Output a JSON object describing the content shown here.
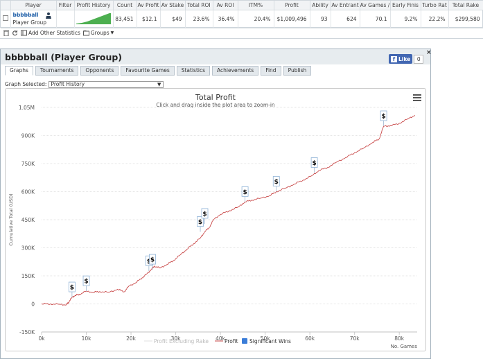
{
  "grid": {
    "headers": [
      "",
      "Player",
      "Filter",
      "Profit History",
      "Count",
      "Av Profit",
      "Av Stake",
      "Total ROI",
      "Av ROI",
      "ITM%",
      "Profit",
      "Ability",
      "Av Entrant",
      "Av Games /",
      "Early Finis",
      "Turbo Rat",
      "Total Rake",
      ""
    ],
    "row": {
      "player_name": "bbbbball",
      "player_sub": "Player Group",
      "count": "83,451",
      "av_profit": "$12.1",
      "av_stake": "$49",
      "total_roi": "23.6%",
      "av_roi": "36.4%",
      "itm": "20.4%",
      "profit": "$1,009,496",
      "ability": "93",
      "av_entrant": "624",
      "av_games": "70.1",
      "early_finis": "9.2%",
      "turbo_rat": "22.2%",
      "total_rake": "$299,580",
      "more": "»"
    },
    "sparkline_color": "#4caf50"
  },
  "toolbar": {
    "delete_icon": "trash-icon",
    "refresh_icon": "refresh-icon",
    "add_stats_label": "Add Other Statistics",
    "groups_label": "Groups"
  },
  "panel": {
    "title": "bbbbball (Player Group)",
    "fb_like_label": "Like",
    "fb_like_count": "0",
    "close": "×",
    "tabs": [
      "Graphs",
      "Tournaments",
      "Opponents",
      "Favourite Games",
      "Statistics",
      "Achievements",
      "Find",
      "Publish"
    ],
    "active_tab": "Graphs",
    "graph_selected_label": "Graph Selected:",
    "graph_selected_value": "Profit History"
  },
  "chart_data": {
    "type": "line",
    "title": "Total Profit",
    "subtitle": "Click and drag inside the plot area to zoom-in",
    "ylabel": "Cumulative Total (USD)",
    "xlabel": "No. Games",
    "xlim": [
      0,
      84000
    ],
    "ylim": [
      -150000,
      1050000
    ],
    "y_ticks": [
      -150000,
      0,
      150000,
      300000,
      450000,
      600000,
      750000,
      900000,
      1050000
    ],
    "y_tick_labels": [
      "-150K",
      "0",
      "150K",
      "300K",
      "450K",
      "600K",
      "750K",
      "900K",
      "1.05M"
    ],
    "x_ticks": [
      0,
      10000,
      20000,
      30000,
      40000,
      50000,
      60000,
      70000,
      80000
    ],
    "x_tick_labels": [
      "0k",
      "10k",
      "20k",
      "30k",
      "40k",
      "50k",
      "60k",
      "70k",
      "80k"
    ],
    "grid": true,
    "legend_position": "bottom",
    "series": [
      {
        "name": "Profit",
        "color": "#c94a4a",
        "x": [
          0,
          2000,
          4000,
          5500,
          6000,
          6800,
          7500,
          8500,
          10000,
          11500,
          13000,
          15000,
          17000,
          18500,
          19500,
          21000,
          22500,
          23500,
          24500,
          25200,
          26500,
          28000,
          29500,
          31000,
          32500,
          34000,
          35500,
          36500,
          37500,
          38500,
          40000,
          42000,
          44000,
          45500,
          47000,
          49000,
          51000,
          52500,
          54500,
          56500,
          58500,
          60500,
          62000,
          64000,
          66000,
          68000,
          70000,
          72000,
          74000,
          75500,
          76500,
          78000,
          80000,
          82000,
          83500
        ],
        "values": [
          0,
          0,
          -2000,
          -5000,
          8000,
          35000,
          45000,
          52000,
          68000,
          62000,
          66000,
          62000,
          78000,
          65000,
          95000,
          112000,
          140000,
          160000,
          183000,
          202000,
          192000,
          210000,
          232000,
          262000,
          292000,
          322000,
          352000,
          386000,
          408000,
          452000,
          478000,
          498000,
          518000,
          545000,
          555000,
          565000,
          578000,
          600000,
          618000,
          640000,
          662000,
          686000,
          712000,
          730000,
          758000,
          782000,
          808000,
          832000,
          862000,
          882000,
          950000,
          952000,
          965000,
          990000,
          1008000
        ]
      },
      {
        "name": "Profit Excluding Rake",
        "color": "#e0e0e0",
        "x": [],
        "values": []
      }
    ],
    "significant_wins": {
      "name": "Significant Wins",
      "color": "#3b7dd8",
      "label": "$",
      "points": [
        {
          "x": 6800,
          "y": 35000
        },
        {
          "x": 10000,
          "y": 68000
        },
        {
          "x": 24000,
          "y": 175000
        },
        {
          "x": 24800,
          "y": 183000
        },
        {
          "x": 35500,
          "y": 385000
        },
        {
          "x": 36500,
          "y": 428000
        },
        {
          "x": 45500,
          "y": 545000
        },
        {
          "x": 52500,
          "y": 600000
        },
        {
          "x": 61000,
          "y": 700000
        },
        {
          "x": 76500,
          "y": 950000
        }
      ]
    }
  }
}
